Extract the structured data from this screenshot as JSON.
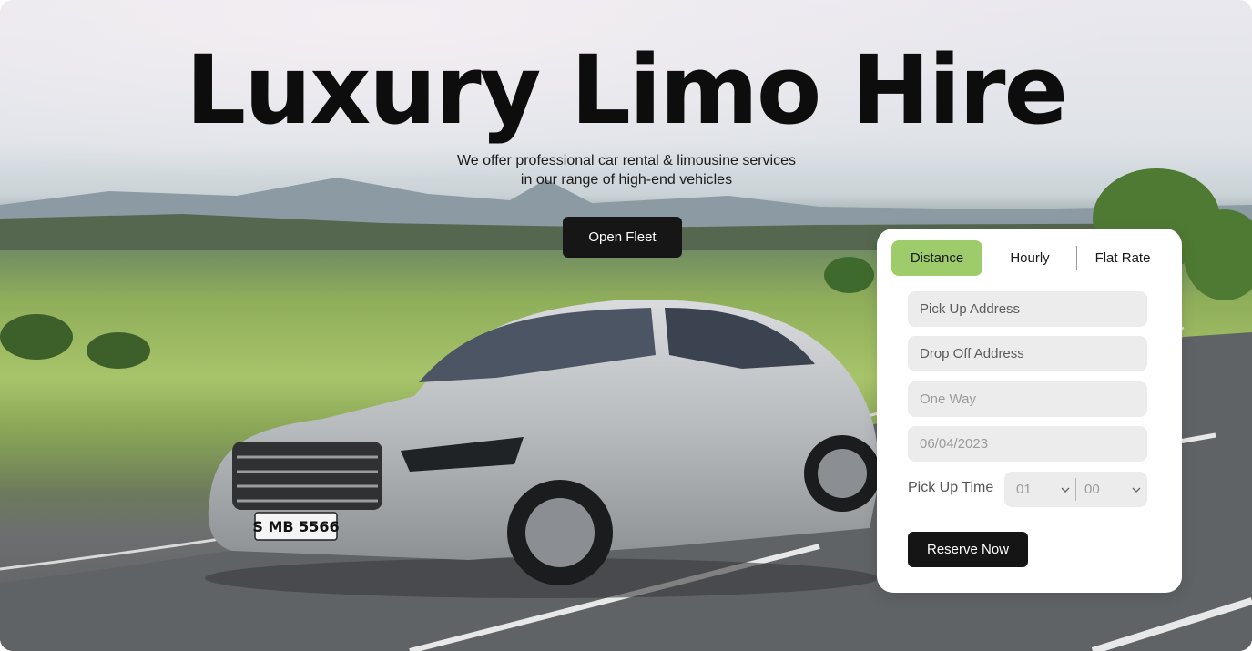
{
  "hero": {
    "title": "Luxury Limo Hire",
    "subtitle_line1": "We offer professional car rental & limousine services",
    "subtitle_line2": "in our range of high-end vehicles",
    "cta_label": "Open Fleet",
    "license_plate": "S MB 5566"
  },
  "booking": {
    "tabs": [
      {
        "label": "Distance",
        "active": true
      },
      {
        "label": "Hourly",
        "active": false
      },
      {
        "label": "Flat Rate",
        "active": false
      }
    ],
    "pickup_placeholder": "Pick Up Address",
    "dropoff_placeholder": "Drop Off Address",
    "trip_type_value": "One Way",
    "date_value": "06/04/2023",
    "time_label": "Pick Up Time",
    "hour_value": "01",
    "minute_value": "00",
    "submit_label": "Reserve Now"
  },
  "colors": {
    "accent": "#9fcc6a",
    "button_dark": "#161616",
    "field_bg": "#ececec"
  }
}
